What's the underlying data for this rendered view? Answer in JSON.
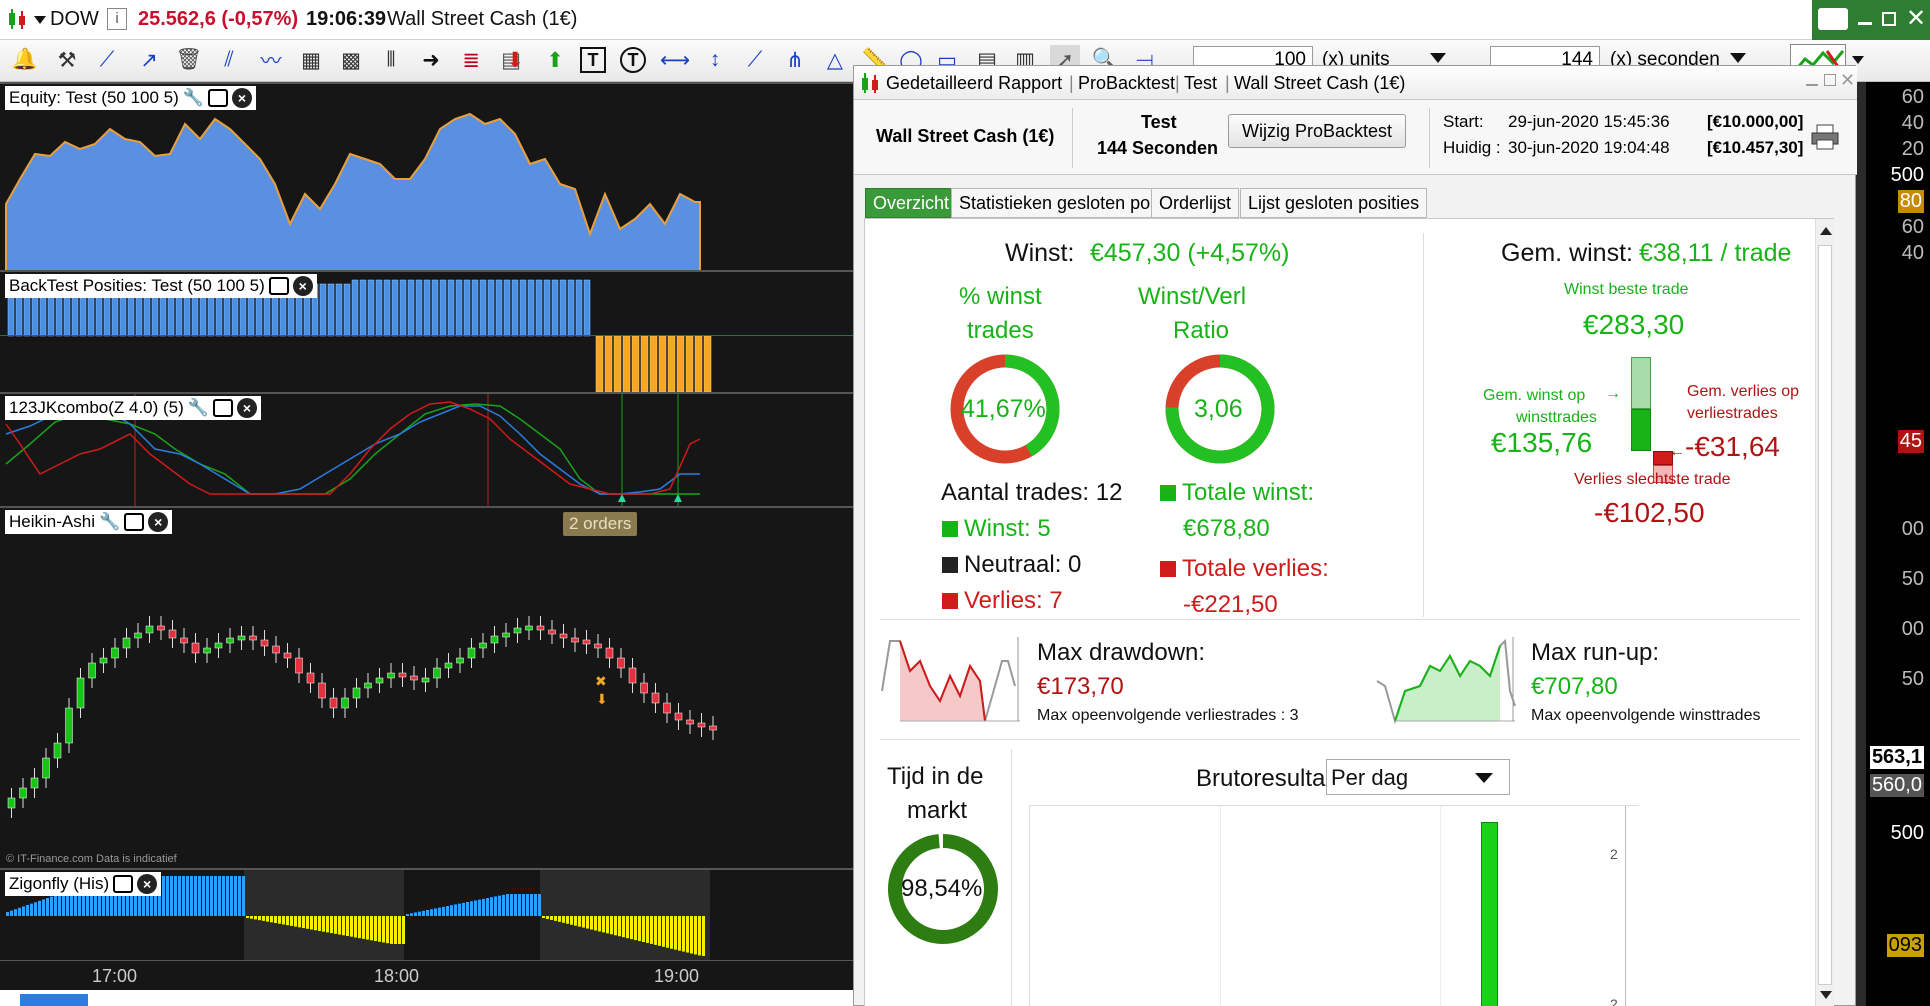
{
  "topbar": {
    "symbol": "DOW",
    "price": "25.562,6 (-0,57%)",
    "time": "19:06:39",
    "instrument": "Wall Street Cash (1€)",
    "price_color": "#c8102e"
  },
  "toolbar": {
    "units_value": "100",
    "units_label": "(x) units",
    "seconds_value": "144",
    "seconds_label": "(x) seconden"
  },
  "panels": {
    "equity": {
      "title": "Equity: Test (50 100 5)"
    },
    "positions": {
      "title": "BackTest Posities: Test (50 100 5)"
    },
    "combo": {
      "title": "123JKcombo(Z 4.0) (5)"
    },
    "heikin": {
      "title": "Heikin-Ashi",
      "orders_badge": "2 orders",
      "copyright": "© IT-Finance.com  Data is indicatief"
    },
    "zigonfly": {
      "title": "Zigonfly (His)"
    }
  },
  "time_axis": [
    "17:00",
    "18:00",
    "19:00"
  ],
  "report": {
    "window_title": "Gedetailleerd Rapport",
    "crumbs": [
      "ProBacktest",
      "Test",
      "Wall Street Cash (1€)"
    ],
    "instrument": "Wall Street Cash (1€)",
    "test_name": "Test",
    "timeframe": "144 Seconden",
    "modify_button": "Wijzig ProBacktest",
    "start_label": "Start:",
    "start_value": "29-jun-2020 15:45:36",
    "start_capital": "[€10.000,00]",
    "current_label": "Huidig :",
    "current_value": "30-jun-2020 19:04:48",
    "current_capital": "[€10.457,30]",
    "tabs": [
      "Overzicht",
      "Statistieken gesloten posities",
      "Orderlijst",
      "Lijst gesloten posities"
    ],
    "win_label": "Winst:",
    "win_value": "€457,30 (+4,57%)",
    "pct_label_1": "% winst",
    "pct_label_2": "trades",
    "pct_value": "41,67%",
    "pct_fraction": 0.4167,
    "ratio_label_1": "Winst/Verl",
    "ratio_label_2": "Ratio",
    "ratio_value": "3,06",
    "ratio_fraction": 0.754,
    "trades_label": "Aantal trades: 12",
    "wins_label": "Winst: 5",
    "neutral_label": "Neutraal: 0",
    "losses_label": "Verlies: 7",
    "total_win_label": "Totale winst:",
    "total_win_value": "€678,80",
    "total_loss_label": "Totale verlies:",
    "total_loss_value": "-€221,50",
    "avg_label": "Gem. winst:",
    "avg_value": "€38,11 / trade",
    "best_label": "Winst beste trade",
    "best_value": "€283,30",
    "avg_win_label_1": "Gem. winst op",
    "avg_win_label_2": "winsttrades",
    "avg_win_value": "€135,76",
    "avg_loss_label_1": "Gem. verlies op",
    "avg_loss_label_2": "verliestrades",
    "avg_loss_value": "-€31,64",
    "worst_label": "Verlies slechtste trade",
    "worst_value": "-€102,50",
    "dd_label": "Max drawdown:",
    "dd_value": "€173,70",
    "dd_sub": "Max opeenvolgende verliestrades : 3",
    "ru_label": "Max run-up:",
    "ru_value": "€707,80",
    "ru_sub": "Max opeenvolgende winsttrades",
    "time_label_1": "Tijd in de",
    "time_label_2": "markt",
    "time_value": "98,54%",
    "time_fraction": 0.9854,
    "bruto_label": "Brutoresultaat",
    "bruto_select": "Per dag",
    "bruto_axis": [
      "2",
      "2"
    ]
  },
  "right_strip": [
    "60",
    "40",
    "20",
    "500",
    "80",
    "60",
    "40",
    "45",
    "00",
    "50",
    "00",
    "50",
    "563,1",
    "560,0",
    "500",
    "093"
  ],
  "colors": {
    "green": "#17b317",
    "red": "#d01b1b",
    "equity_fill": "#5b8fe0",
    "equity_line": "#e8a03c",
    "orange": "#f5a623",
    "blue_bar": "#4a90e2",
    "yellow": "#f4f000"
  }
}
